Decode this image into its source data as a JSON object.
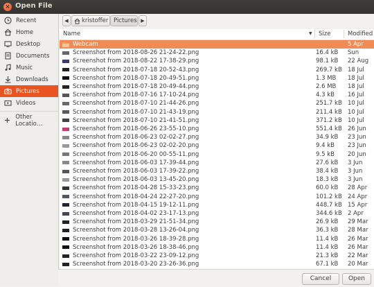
{
  "window": {
    "title": "Open File"
  },
  "sidebar": {
    "items": [
      {
        "label": "Recent",
        "icon": "clock-icon"
      },
      {
        "label": "Home",
        "icon": "home-icon"
      },
      {
        "label": "Desktop",
        "icon": "desktop-icon"
      },
      {
        "label": "Documents",
        "icon": "documents-icon"
      },
      {
        "label": "Music",
        "icon": "music-icon"
      },
      {
        "label": "Downloads",
        "icon": "download-icon"
      },
      {
        "label": "Pictures",
        "icon": "camera-icon",
        "active": true
      },
      {
        "label": "Videos",
        "icon": "video-icon"
      },
      {
        "label": "Other Locatio…",
        "icon": "plus-icon"
      }
    ]
  },
  "pathbar": {
    "segments": [
      "kristoffer",
      "Pictures"
    ]
  },
  "columns": {
    "name": "Name",
    "size": "Size",
    "modified": "Modified"
  },
  "files": [
    {
      "name": "Webcam",
      "size": "",
      "modified": "5 Apr",
      "type": "folder",
      "selected": true
    },
    {
      "name": "Screenshot from 2018-08-26 21-24-22.png",
      "size": "16.4 kB",
      "modified": "Sun"
    },
    {
      "name": "Screenshot from 2018-08-22 17-38-29.png",
      "size": "98.1 kB",
      "modified": "22 Aug"
    },
    {
      "name": "Screenshot from 2018-07-18 20-52-43.png",
      "size": "269.7 kB",
      "modified": "18 Jul"
    },
    {
      "name": "Screenshot from 2018-07-18 20-49-51.png",
      "size": "1.3 MB",
      "modified": "18 Jul"
    },
    {
      "name": "Screenshot from 2018-07-18 20-49-44.png",
      "size": "2.6 MB",
      "modified": "18 Jul"
    },
    {
      "name": "Screenshot from 2018-07-16 17-10-24.png",
      "size": "4.3 kB",
      "modified": "16 Jul"
    },
    {
      "name": "Screenshot from 2018-07-10 21-44-26.png",
      "size": "251.7 kB",
      "modified": "10 Jul"
    },
    {
      "name": "Screenshot from 2018-07-10 21-43-19.png",
      "size": "211.4 kB",
      "modified": "10 Jul"
    },
    {
      "name": "Screenshot from 2018-07-10 21-41-51.png",
      "size": "371.2 kB",
      "modified": "10 Jul"
    },
    {
      "name": "Screenshot from 2018-06-26 23-55-10.png",
      "size": "551.4 kB",
      "modified": "26 Jun"
    },
    {
      "name": "Screenshot from 2018-06-23 02-02-27.png",
      "size": "34.9 kB",
      "modified": "23 Jun"
    },
    {
      "name": "Screenshot from 2018-06-23 02-02-20.png",
      "size": "9.4 kB",
      "modified": "23 Jun"
    },
    {
      "name": "Screenshot from 2018-06-20 00-55-11.png",
      "size": "9.5 kB",
      "modified": "20 Jun"
    },
    {
      "name": "Screenshot from 2018-06-03 17-39-44.png",
      "size": "27.6 kB",
      "modified": "3 Jun"
    },
    {
      "name": "Screenshot from 2018-06-03 17-39-22.png",
      "size": "38.4 kB",
      "modified": "3 Jun"
    },
    {
      "name": "Screenshot from 2018-06-03 13-45-20.png",
      "size": "18.3 kB",
      "modified": "3 Jun"
    },
    {
      "name": "Screenshot from 2018-04-28 15-33-23.png",
      "size": "60.0 kB",
      "modified": "28 Apr"
    },
    {
      "name": "Screenshot from 2018-04-24 22-27-20.png",
      "size": "101.2 kB",
      "modified": "24 Apr"
    },
    {
      "name": "Screenshot from 2018-04-15 19-12-11.png",
      "size": "448.7 kB",
      "modified": "15 Apr"
    },
    {
      "name": "Screenshot from 2018-04-02 23-17-13.png",
      "size": "344.6 kB",
      "modified": "2 Apr"
    },
    {
      "name": "Screenshot from 2018-03-29 21-51-34.png",
      "size": "26.9 kB",
      "modified": "29 Mar"
    },
    {
      "name": "Screenshot from 2018-03-28 13-26-04.png",
      "size": "36.3 kB",
      "modified": "28 Mar"
    },
    {
      "name": "Screenshot from 2018-03-26 18-39-28.png",
      "size": "11.4 kB",
      "modified": "26 Mar"
    },
    {
      "name": "Screenshot from 2018-03-26 18-38-46.png",
      "size": "11.4 kB",
      "modified": "26 Mar"
    },
    {
      "name": "Screenshot from 2018-03-22 23-09-12.png",
      "size": "21.3 kB",
      "modified": "22 Mar"
    },
    {
      "name": "Screenshot from 2018-03-20 23-26-36.png",
      "size": "67.1 kB",
      "modified": "20 Mar"
    }
  ],
  "footer": {
    "cancel_label": "Cancel",
    "open_label": "Open"
  },
  "colors": {
    "accent": "#e95420",
    "selected_row": "#f18b56",
    "titlebar": "#3c3b37"
  }
}
